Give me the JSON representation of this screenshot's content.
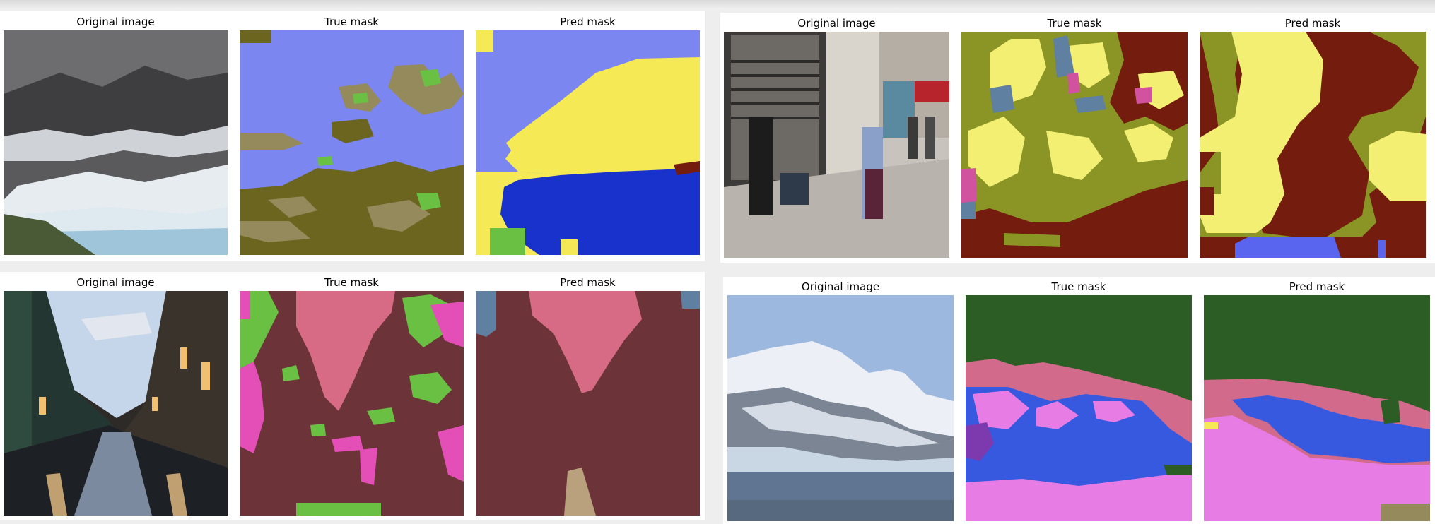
{
  "panels": [
    {
      "titles": {
        "original": "Original image",
        "true_mask": "True mask",
        "pred_mask": "Pred mask"
      }
    },
    {
      "titles": {
        "original": "Original image",
        "true_mask": "True mask",
        "pred_mask": "Pred mask"
      }
    },
    {
      "titles": {
        "original": "Original image",
        "true_mask": "True mask",
        "pred_mask": "Pred mask"
      }
    },
    {
      "titles": {
        "original": "Original image",
        "true_mask": "True mask",
        "pred_mask": "Pred mask"
      }
    }
  ],
  "colors": {
    "sky_blue": "#7b86f0",
    "olive_dark": "#6b6520",
    "khaki": "#958a5c",
    "green": "#69c043",
    "yellow": "#f5ea55",
    "royal_blue": "#1a32cc",
    "maroon": "#741c0d",
    "olive": "#8a9526",
    "pale_yellow": "#f2ef73",
    "steel_blue": "#5f80a0",
    "pink": "#d1529e",
    "periwinkle": "#5965ee",
    "brown_red": "#6c3438",
    "rose": "#d76b85",
    "magenta": "#e44fb7",
    "lime": "#69c043",
    "tan": "#b9a17e",
    "forest": "#2c5d24",
    "salmon": "#d26a8b",
    "blue": "#3659e0",
    "violet": "#e77ce4",
    "purple": "#7d3aae"
  }
}
